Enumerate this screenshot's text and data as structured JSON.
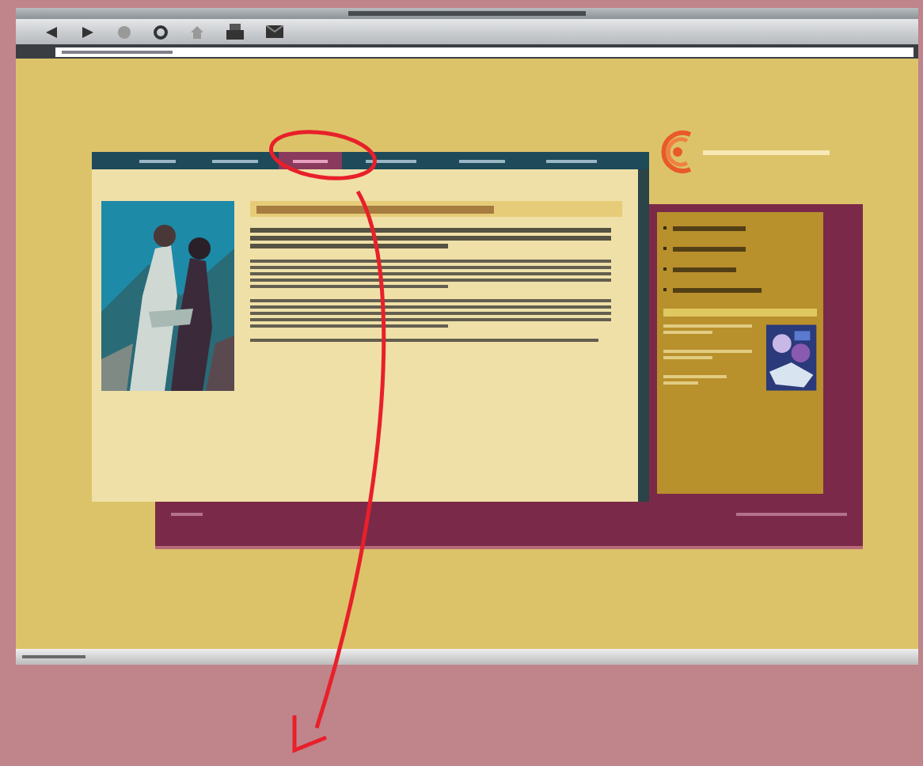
{
  "nav": {
    "items": [
      {
        "selected": false
      },
      {
        "selected": false
      },
      {
        "selected": true
      },
      {
        "selected": false
      },
      {
        "selected": false
      },
      {
        "selected": false
      }
    ]
  }
}
